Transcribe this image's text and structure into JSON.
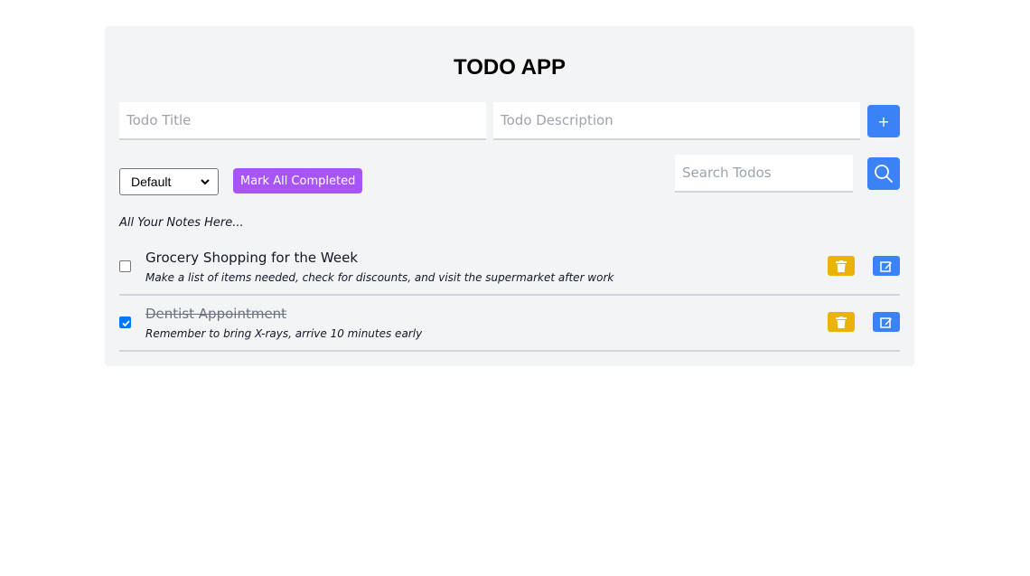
{
  "app": {
    "title": "TODO APP"
  },
  "form": {
    "title_placeholder": "Todo Title",
    "title_value": "",
    "description_placeholder": "Todo Description",
    "description_value": "",
    "add_label": "+"
  },
  "controls": {
    "filter_selected": "Default",
    "mark_all_label": "Mark All Completed",
    "search_placeholder": "Search Todos",
    "search_value": "",
    "search_icon": "search-icon"
  },
  "notes_heading": "All Your Notes Here...",
  "todos": [
    {
      "title": "Grocery Shopping for the Week",
      "description": "Make a list of items needed, check for discounts, and visit the supermarket after work",
      "completed": false
    },
    {
      "title": "Dentist Appointment",
      "description": "Remember to bring X-rays, arrive 10 minutes early",
      "completed": true
    }
  ],
  "colors": {
    "card_bg": "#f3f4f6",
    "primary": "#3b82f6",
    "mark_all": "#a855f7",
    "delete": "#eab308"
  }
}
